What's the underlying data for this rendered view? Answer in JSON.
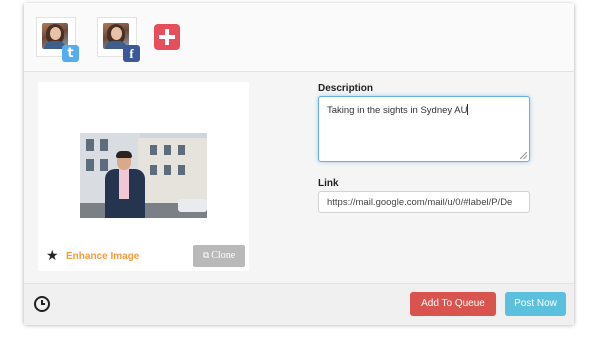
{
  "accounts": [
    {
      "network": "Twitter",
      "badge_glyph": "t",
      "badge_color": "#55acee"
    },
    {
      "network": "Facebook",
      "badge_glyph": "f",
      "badge_color": "#3b5998"
    }
  ],
  "add_account": {
    "icon": "plus-icon",
    "color": "#e54e5a"
  },
  "media": {
    "enhance_label": "Enhance Image",
    "enhance_icon": "magic-star-icon",
    "clone_label": "Clone",
    "clone_icon": "clone-icon"
  },
  "description": {
    "label": "Description",
    "value": "Taking in the sights in Sydney AU"
  },
  "link": {
    "label": "Link",
    "value": "https://mail.google.com/mail/u/0/#label/P/De"
  },
  "footer": {
    "schedule_icon": "clock-icon",
    "queue_label": "Add To Queue",
    "post_label": "Post Now",
    "queue_color": "#d9534f",
    "post_color": "#5bc0de"
  }
}
